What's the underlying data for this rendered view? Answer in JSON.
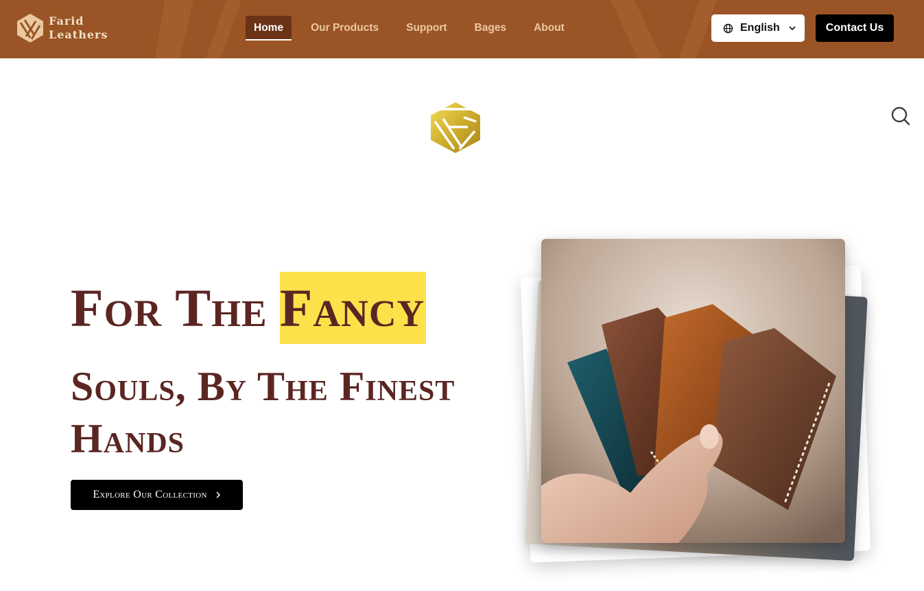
{
  "brand": {
    "name_line1": "Farid",
    "name_line2": "Leathers"
  },
  "nav": {
    "items": [
      {
        "label": "Home",
        "active": true
      },
      {
        "label": "Our Products",
        "active": false
      },
      {
        "label": "Support",
        "active": false
      },
      {
        "label": "Bages",
        "active": false
      },
      {
        "label": "About",
        "active": false
      }
    ]
  },
  "language": {
    "selected": "English",
    "icon": "globe-icon"
  },
  "header_actions": {
    "contact_label": "Contact Us"
  },
  "hero": {
    "line1_prefix": "For The",
    "line1_highlight": "Fancy",
    "line2": "Souls, By The Finest Hands",
    "cta_label": "Explore Our Collection",
    "image_alt": "hand holding leather card wallets"
  },
  "colors": {
    "header_bg": "#9a5425",
    "nav_active_bg": "#6b3315",
    "heading": "#5b2622",
    "highlight": "#fde14a",
    "gold": "#d4b33a"
  }
}
